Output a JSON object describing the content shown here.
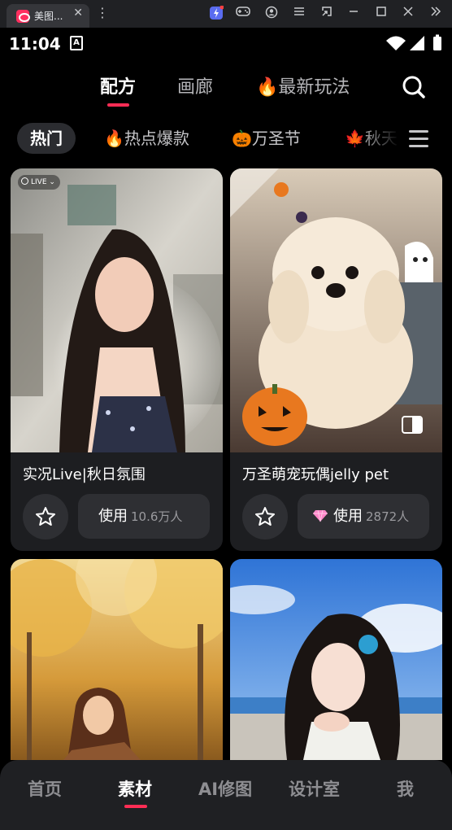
{
  "window": {
    "tab_title": "美图...",
    "tab_close": "✕",
    "kebab": "⋮",
    "icons": [
      "extension-icon",
      "gamepad-icon",
      "account-icon",
      "menu-icon",
      "fullscreen-exit-icon",
      "minimize-icon",
      "maximize-icon",
      "close-icon",
      "chevron-double-right-icon"
    ]
  },
  "status_bar": {
    "time": "11:04",
    "app_badge": "A"
  },
  "top_nav": {
    "tabs": [
      {
        "label": "配方",
        "active": true
      },
      {
        "label": "画廊",
        "active": false
      },
      {
        "label": "🔥最新玩法",
        "active": false
      }
    ],
    "accent": "#ff2d55"
  },
  "chips": [
    {
      "label": "热门",
      "active": true
    },
    {
      "label": "🔥热点爆款",
      "active": false
    },
    {
      "label": "🎃万圣节",
      "active": false
    },
    {
      "label": "🍁秋天",
      "active": false
    }
  ],
  "cards": [
    {
      "title": "实况Live|秋日氛围",
      "badge": "LIVE",
      "use_label": "使用",
      "use_count": "10.6万人"
    },
    {
      "title": "万圣萌宠玩偶jelly pet",
      "use_icon": "diamond-icon",
      "use_label": "使用",
      "use_count": "2872人"
    },
    {
      "title": ""
    },
    {
      "title": ""
    }
  ],
  "bottom_nav": {
    "items": [
      {
        "label": "首页",
        "active": false
      },
      {
        "label": "素材",
        "active": true
      },
      {
        "label": "AI修图",
        "active": false
      },
      {
        "label": "设计室",
        "active": false
      },
      {
        "label": "我",
        "active": false
      }
    ]
  }
}
